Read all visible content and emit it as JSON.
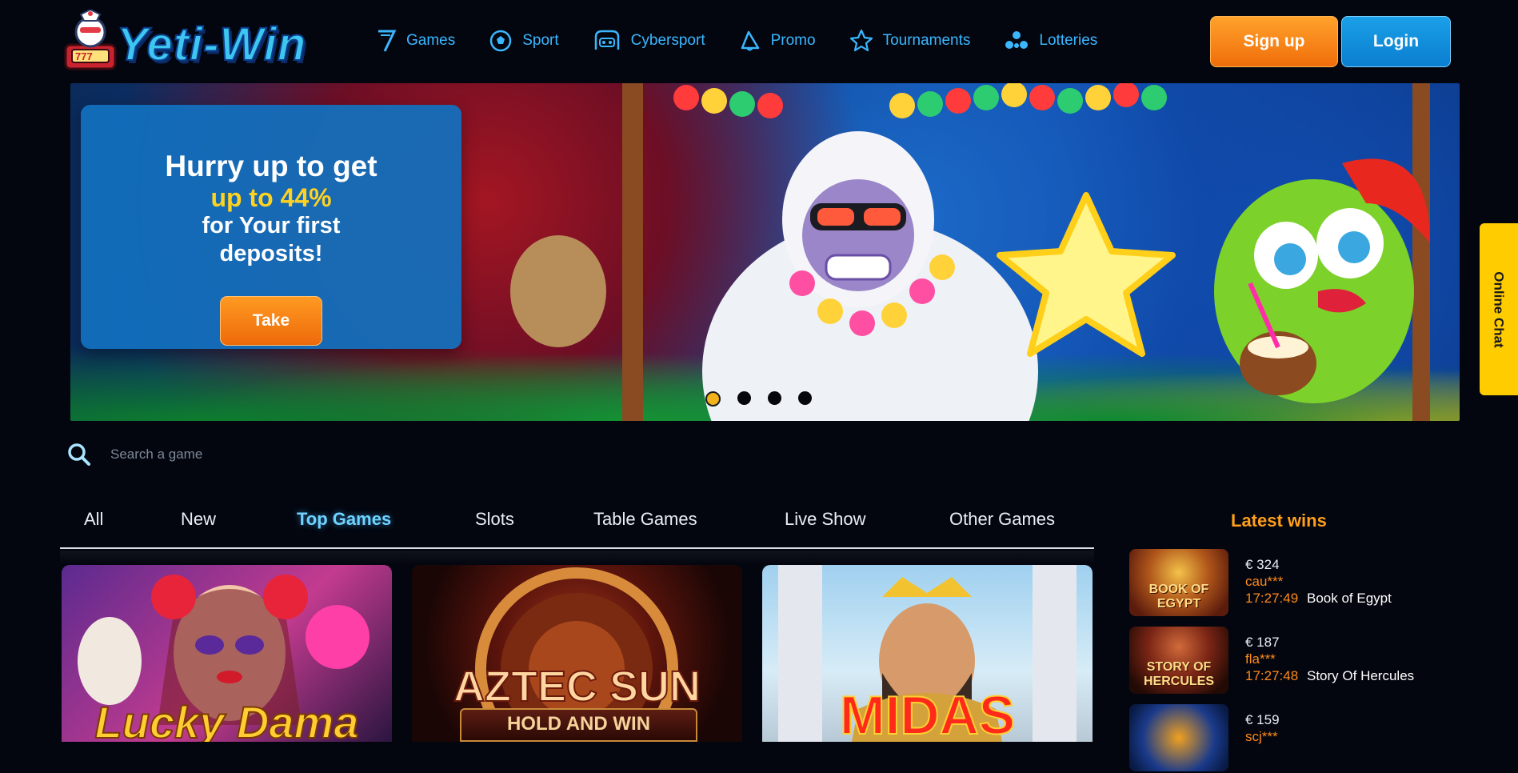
{
  "header": {
    "logo_text": "Yeti-Win",
    "nav": [
      {
        "label": "Games",
        "icon": "seven-icon"
      },
      {
        "label": "Sport",
        "icon": "soccer-ball-icon"
      },
      {
        "label": "Cybersport",
        "icon": "gamepad-icon"
      },
      {
        "label": "Promo",
        "icon": "megaphone-icon"
      },
      {
        "label": "Tournaments",
        "icon": "star-icon"
      },
      {
        "label": "Lotteries",
        "icon": "lottery-icon"
      }
    ],
    "signup_label": "Sign up",
    "login_label": "Login"
  },
  "banner": {
    "title": "Hurry up to get",
    "highlight": "up to 44%",
    "subtitle": "for Your first deposits!",
    "cta_label": "Take",
    "slide_count": 4,
    "active_slide": 0
  },
  "online_chat_label": "Online Chat",
  "search": {
    "placeholder": "Search a game"
  },
  "tabs": [
    {
      "label": "All",
      "active": false
    },
    {
      "label": "New",
      "active": false
    },
    {
      "label": "Top Games",
      "active": true
    },
    {
      "label": "Slots",
      "active": false
    },
    {
      "label": "Table Games",
      "active": false
    },
    {
      "label": "Live Show",
      "active": false
    },
    {
      "label": "Other Games",
      "active": false
    }
  ],
  "games": [
    {
      "title": "Lucky Dama"
    },
    {
      "title": "AZTEC SUN",
      "subtitle": "HOLD AND WIN"
    },
    {
      "title": "MIDAS"
    }
  ],
  "latest_wins": {
    "title": "Latest wins",
    "items": [
      {
        "amount": "€ 324",
        "user": "cau***",
        "time": "17:27:49",
        "game": "Book of Egypt",
        "thumb_label": "BOOK OF EGYPT"
      },
      {
        "amount": "€ 187",
        "user": "fla***",
        "time": "17:27:48",
        "game": "Story Of Hercules",
        "thumb_label": "STORY OF HERCULES"
      },
      {
        "amount": "€ 159",
        "user": "scj***",
        "time": "",
        "game": "",
        "thumb_label": ""
      }
    ]
  },
  "colors": {
    "accent_orange": "#ff9f1a",
    "accent_blue": "#3ab7ff",
    "chat_yellow": "#ffcc00",
    "background": "#03060f"
  }
}
